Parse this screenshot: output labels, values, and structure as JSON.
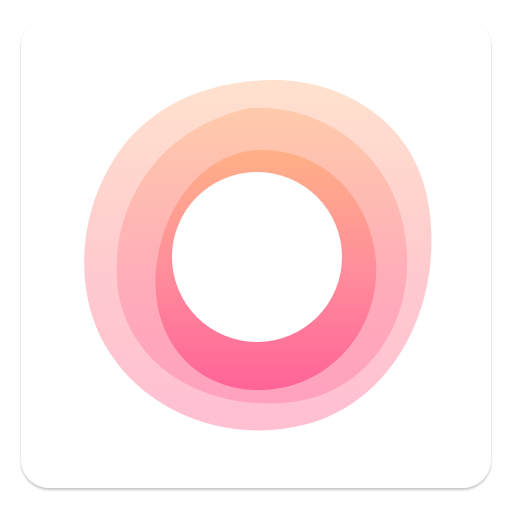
{
  "app_icon": {
    "icon": "ring-logo-icon",
    "colors": {
      "tile_background": "#ffffff",
      "gradient_top": "#ffb48a",
      "gradient_bottom": "#ff5f94",
      "outer_layer": "#ffc6cf",
      "center": "#ffffff"
    }
  }
}
